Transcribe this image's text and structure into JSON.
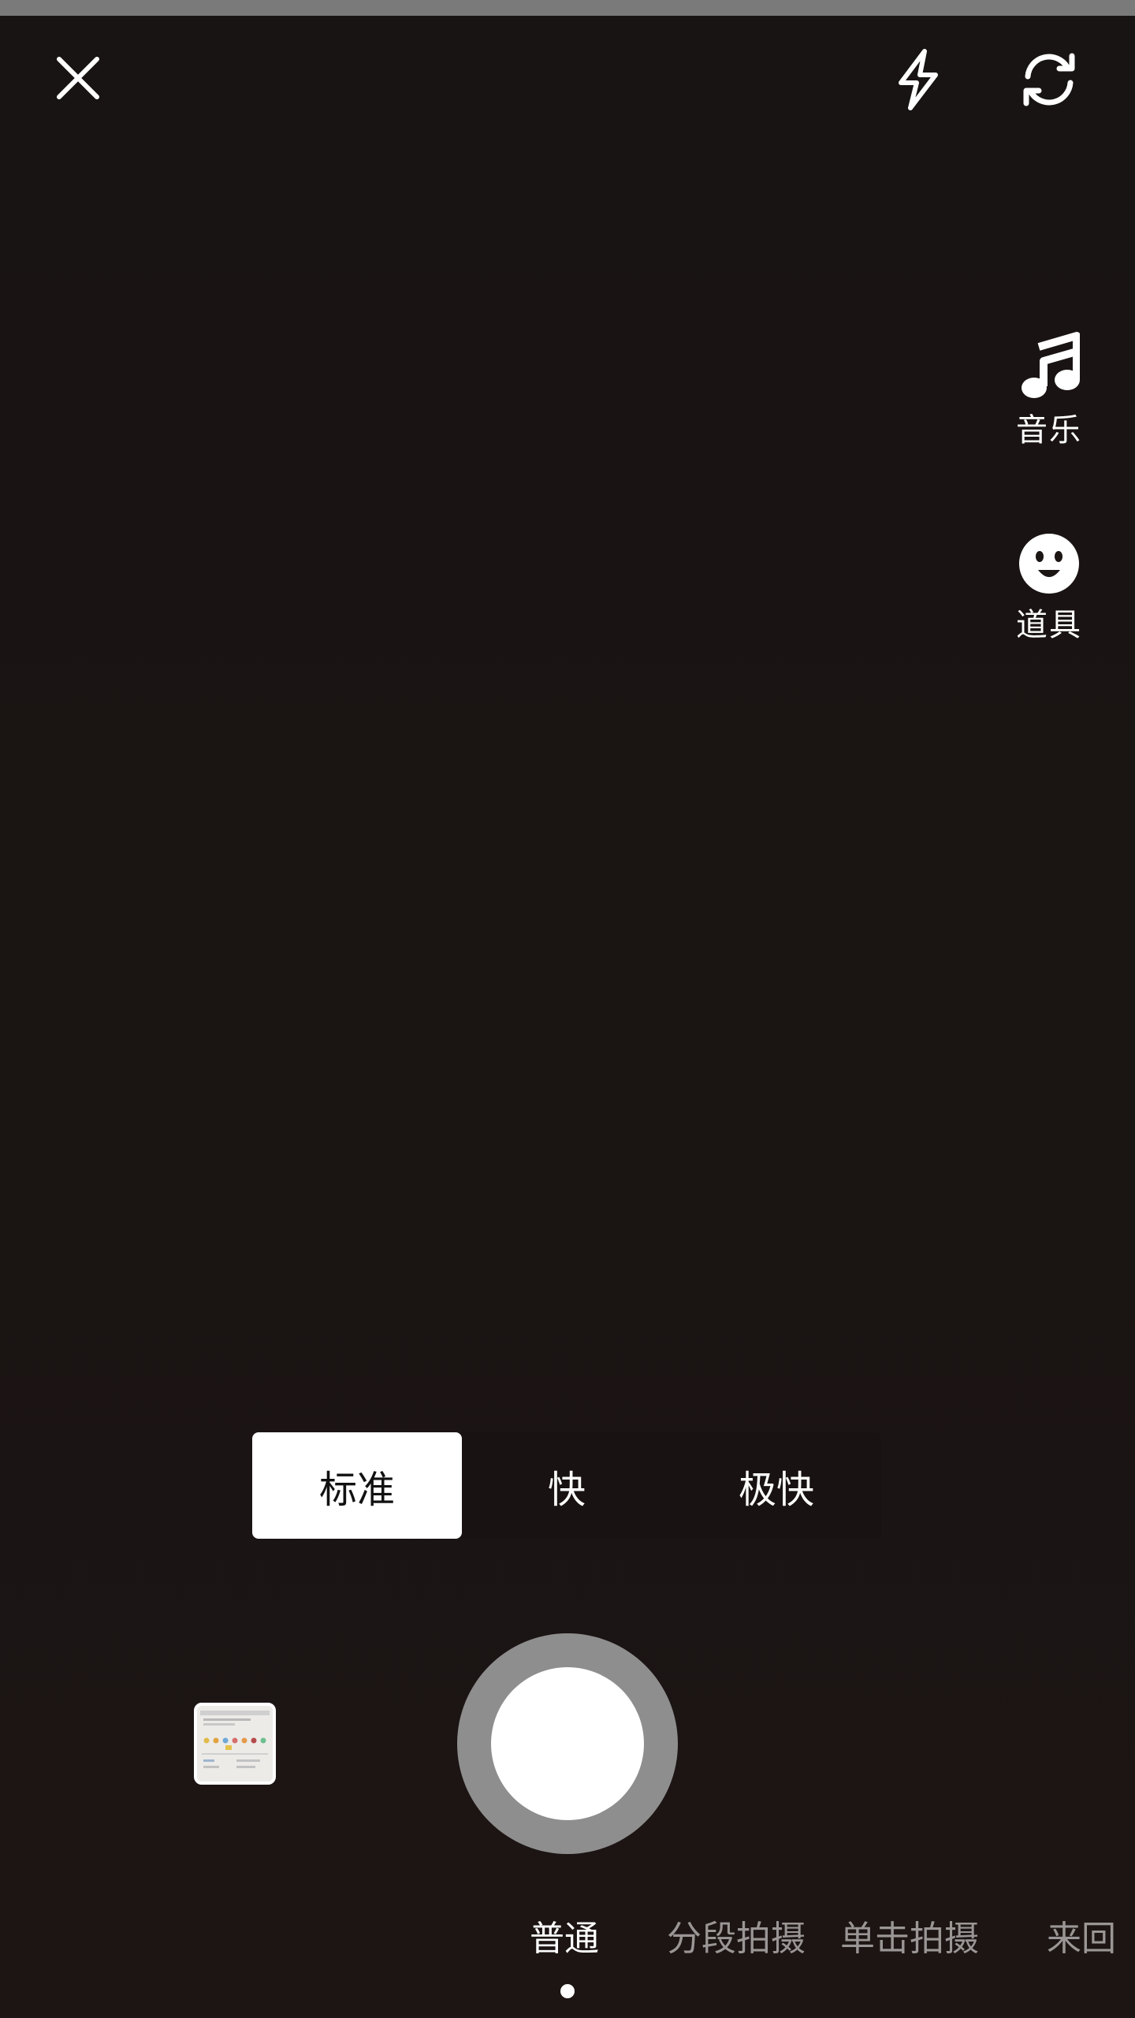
{
  "icons": {
    "close": "close-icon",
    "flash": "flash-icon",
    "flip": "flip-camera-icon",
    "music": "music-note-icon",
    "props": "smiley-face-icon",
    "gallery": "gallery-thumbnail"
  },
  "side_tools": {
    "music_label": "音乐",
    "props_label": "道具"
  },
  "speed": {
    "options": [
      "标准",
      "快",
      "极快"
    ],
    "selected": "标准"
  },
  "modes": {
    "tabs": [
      "普通",
      "分段拍摄",
      "单击拍摄",
      "来回"
    ],
    "selected": "普通"
  },
  "colors": {
    "background": "#1b1514",
    "accent": "#ffffff",
    "shutter_ring": "#8f8e8e",
    "inactive_text": "#9b9696"
  }
}
